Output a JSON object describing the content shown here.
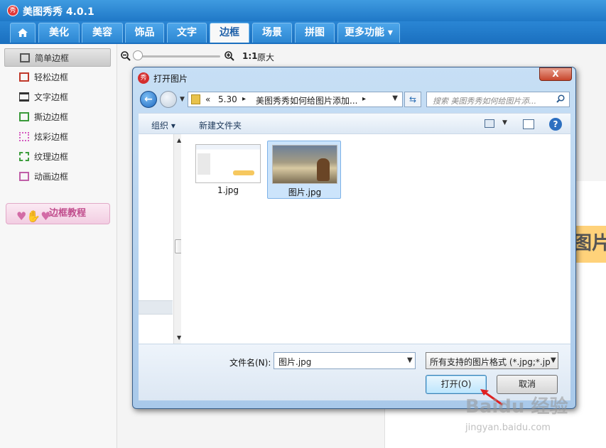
{
  "app": {
    "title": "美图秀秀 4.0.1",
    "logo_glyph": "秀"
  },
  "tabs": [
    {
      "label": "美化"
    },
    {
      "label": "美容"
    },
    {
      "label": "饰品"
    },
    {
      "label": "文字"
    },
    {
      "label": "边框"
    },
    {
      "label": "场景"
    },
    {
      "label": "拼图"
    },
    {
      "label": "更多功能 ▾"
    }
  ],
  "sidebar": {
    "items": [
      {
        "label": "简单边框"
      },
      {
        "label": "轻松边框"
      },
      {
        "label": "文字边框"
      },
      {
        "label": "撕边边框"
      },
      {
        "label": "炫彩边框"
      },
      {
        "label": "纹理边框"
      },
      {
        "label": "动画边框"
      }
    ],
    "tutorial_label": "边框教程"
  },
  "zoom": {
    "ratio": "1:1",
    "original_label": "原大",
    "level": 0
  },
  "canvas": {
    "visible_text": "图片"
  },
  "dialog": {
    "title": "打开图片",
    "close_label": "X",
    "address": {
      "prefix": "«",
      "segment1": "5.30",
      "sep": "▸",
      "segment2": "美图秀秀如何给图片添加...",
      "sep2": "▸"
    },
    "search_placeholder": "搜索 美图秀秀如何给图片添...",
    "toolbar": {
      "organize": "组织 ▾",
      "new_folder": "新建文件夹",
      "help": "?"
    },
    "files": [
      {
        "name": "1.jpg",
        "selected": false
      },
      {
        "name": "图片.jpg",
        "selected": true
      }
    ],
    "filename_label": "文件名(N):",
    "filename_value": "图片.jpg",
    "filter_value": "所有支持的图片格式 (*.jpg;*.jp",
    "open_button": "打开(O)",
    "cancel_button": "取消"
  },
  "watermark": {
    "text": "Baidu 经验",
    "url": "jingyan.baidu.com"
  },
  "colors": {
    "titlebar": "#1f78c7",
    "accent_red": "#d42e2e",
    "selection": "#cce4fb"
  }
}
